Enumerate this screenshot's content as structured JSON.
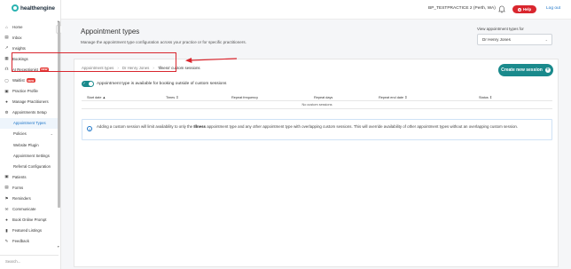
{
  "brand": {
    "name": "healthengine"
  },
  "sidebar": {
    "items": [
      {
        "label": "Home",
        "icon": "home-icon",
        "glyph": "⌂"
      },
      {
        "label": "Inbox",
        "icon": "inbox-icon",
        "glyph": "▤"
      },
      {
        "label": "Insights",
        "icon": "insights-icon",
        "glyph": "↗"
      },
      {
        "label": "Bookings",
        "icon": "calendar-icon",
        "glyph": "▦"
      },
      {
        "label": "AI Receptionist",
        "icon": "headset-icon",
        "glyph": "☊",
        "badge": "NEW"
      },
      {
        "label": "Waitlist",
        "icon": "waitlist-icon",
        "glyph": "▢",
        "badge": "NEW"
      },
      {
        "label": "Practice Profile",
        "icon": "profile-icon",
        "glyph": "▣"
      },
      {
        "label": "Manage Practitioners",
        "icon": "practitioners-icon",
        "glyph": "●"
      },
      {
        "label": "Appointments Setup",
        "icon": "gear-icon",
        "glyph": "⚙"
      }
    ],
    "sub_items": [
      {
        "label": "Appointment Types",
        "active": true
      },
      {
        "label": "Policies",
        "chevron": "⌄"
      },
      {
        "label": "Website Plugin"
      },
      {
        "label": "Appointment Settings"
      },
      {
        "label": "Referral Configuration"
      }
    ],
    "more_items": [
      {
        "label": "Patients",
        "icon": "patients-icon",
        "glyph": "▣"
      },
      {
        "label": "Forms",
        "icon": "forms-icon",
        "glyph": "▤"
      },
      {
        "label": "Reminders",
        "icon": "reminders-icon",
        "glyph": "⚑"
      },
      {
        "label": "Communicate",
        "icon": "communicate-icon",
        "glyph": "✉"
      },
      {
        "label": "Book Online Prompt",
        "icon": "book-online-icon",
        "glyph": "●"
      },
      {
        "label": "Featured Listings",
        "icon": "featured-icon",
        "glyph": "▮"
      },
      {
        "label": "Feedback",
        "icon": "feedback-icon",
        "glyph": "✎"
      }
    ],
    "search_placeholder": "Search..."
  },
  "topbar": {
    "practice": "BP_TESTPRACTICE 2 (Perth, WA)",
    "help_label": "Help",
    "logout_label": "Log out"
  },
  "header": {
    "title": "Appointment types",
    "subtitle": "Manage the appointment type configuration across your practice or for specific practitioners.",
    "view_label": "View appointment types for",
    "view_value": "Dr Henry Jones"
  },
  "breadcrumb": {
    "items": [
      "Appointment types",
      "Dr Henry Jones",
      "'Illness' custom sessions"
    ]
  },
  "actions": {
    "create_label": "Create new session"
  },
  "toggle": {
    "label": "Appointment type is available for booking outside of custom sessions",
    "checked": true
  },
  "table": {
    "columns": [
      "Start date",
      "Times",
      "Repeat frequency",
      "Repeat days",
      "Repeat end date",
      "Status"
    ],
    "empty_text": "No custom sessions"
  },
  "info": {
    "text_before": "Adding a custom session will limit availability to only the ",
    "bold": "Illness",
    "text_after": " appointment type and any other appointment type with overlapping custom sessions. This will override availability of other appointment types without an overlapping custom session."
  },
  "colors": {
    "accent": "#1a8a8c",
    "help": "#d9262e",
    "link": "#1a73c7",
    "highlight": "#d9262e"
  }
}
